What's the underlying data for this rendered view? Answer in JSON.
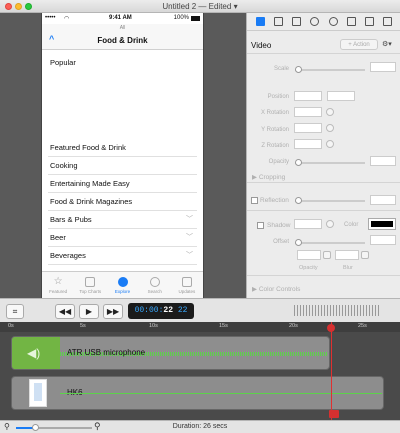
{
  "window": {
    "title": "Untitled 2 — Edited",
    "title_arrow": "▾"
  },
  "phone": {
    "status_signal": "•••••",
    "status_carrier": "",
    "status_time": "9:41 AM",
    "status_battery": "100%",
    "nav_small": "All",
    "nav_back": "^",
    "nav_title": "Food & Drink",
    "list_top": "Popular",
    "list_items": [
      {
        "label": "Featured Food & Drink",
        "chevron": false
      },
      {
        "label": "Cooking",
        "chevron": false
      },
      {
        "label": "Entertaining Made Easy",
        "chevron": false
      },
      {
        "label": "Food & Drink Magazines",
        "chevron": false
      },
      {
        "label": "Bars & Pubs",
        "chevron": true
      },
      {
        "label": "Beer",
        "chevron": true
      },
      {
        "label": "Beverages",
        "chevron": true
      }
    ],
    "tabs": [
      "Featured",
      "Top Charts",
      "Explore",
      "Search",
      "Updates"
    ],
    "active_tab": 2,
    "accent": "#1a7cf5"
  },
  "inspector": {
    "section_title": "Video",
    "action_button": "+ Action",
    "gear": "⚙▾",
    "labels": {
      "scale": "Scale",
      "position": "Position",
      "x_rotation": "X Rotation",
      "y_rotation": "Y Rotation",
      "z_rotation": "Z Rotation",
      "opacity": "Opacity",
      "cropping": "Cropping",
      "reflection": "Reflection",
      "shadow": "Shadow",
      "color": "Color",
      "offset": "Offset",
      "opacity2": "Opacity",
      "blur": "Blur",
      "color_controls": "Color Controls"
    }
  },
  "controls": {
    "rewind": "◀◀",
    "play": "▶",
    "forward": "▶▶",
    "timecode_prefix": "00:00:",
    "timecode_sec": "22",
    "timecode_frames": "22"
  },
  "timeline": {
    "ruler_labels": [
      "0s",
      "5s",
      "10s",
      "15s",
      "20s",
      "25s"
    ],
    "clips": [
      {
        "label": "ATR USB microphone",
        "type": "audio"
      },
      {
        "label": "HK6",
        "type": "video"
      }
    ],
    "clip_colors": {
      "audio": "#72b544",
      "wave": "#5cd24a"
    }
  },
  "bottom": {
    "duration": "Duration: 26 secs"
  }
}
